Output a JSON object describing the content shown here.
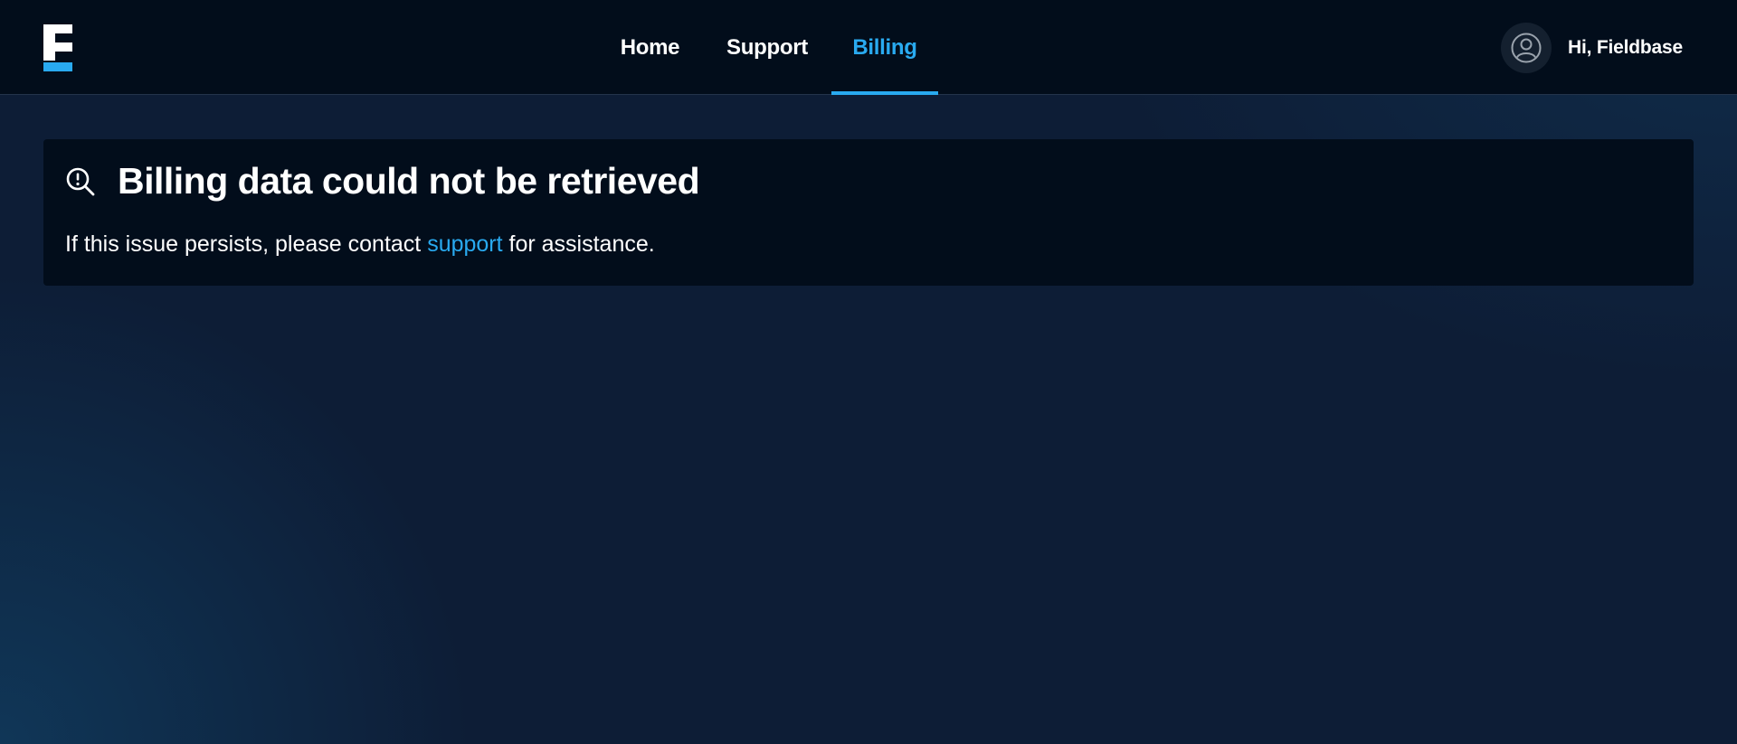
{
  "nav": {
    "items": [
      {
        "label": "Home",
        "active": false
      },
      {
        "label": "Support",
        "active": false
      },
      {
        "label": "Billing",
        "active": true
      }
    ]
  },
  "user": {
    "greeting": "Hi, Fieldbase",
    "avatar_icon": "user-circle-icon"
  },
  "error_card": {
    "icon": "search-alert-icon",
    "title": "Billing data could not be retrieved",
    "message_prefix": "If this issue persists, please contact ",
    "link_label": "support",
    "message_suffix": " for assistance."
  },
  "colors": {
    "accent": "#29aaf0",
    "header_bg": "#020d1b",
    "page_bg": "#0d1d36",
    "card_bg": "#020d1b",
    "text": "#ffffff"
  }
}
